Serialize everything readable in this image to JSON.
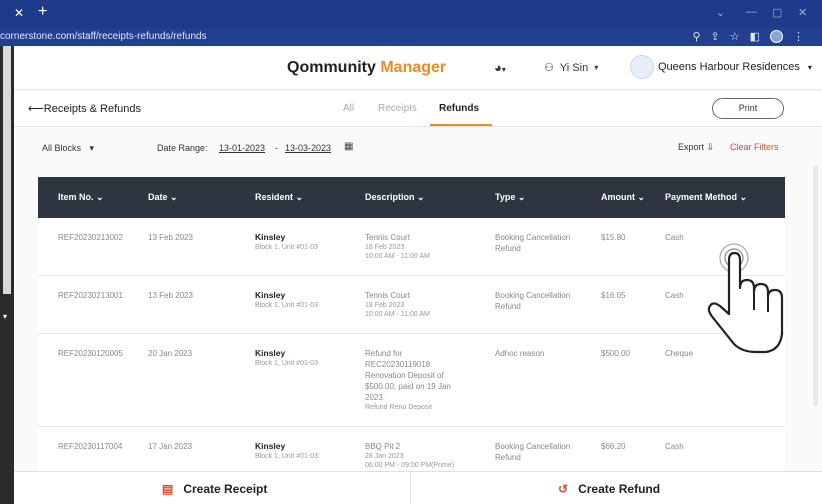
{
  "browser": {
    "url": "cornerstone.com/staff/receipts-refunds/refunds",
    "close_glyph": "✕",
    "new_tab_glyph": "+"
  },
  "header": {
    "brand_prefix": "Qommunity",
    "brand_suffix": "Manager",
    "user": "Yi Sin",
    "org": "Queens Harbour Residences"
  },
  "subbar": {
    "back_label": "Receipts & Refunds",
    "tabs": [
      {
        "label": "All"
      },
      {
        "label": "Receipts"
      },
      {
        "label": "Refunds"
      }
    ],
    "print_label": "Print"
  },
  "filters": {
    "blocks_label": "All Blocks",
    "date_range_label": "Date Range:",
    "date_from": "13-01-2023",
    "date_to": "13-03-2023",
    "export_label": "Export",
    "clear_label": "Clear Filters"
  },
  "table": {
    "columns": [
      "Item No.",
      "Date",
      "Resident",
      "Description",
      "Type",
      "Amount",
      "Payment Method"
    ],
    "rows": [
      {
        "item": "REF20230213002",
        "date": "13 Feb 2023",
        "resident": "Kinsley",
        "unit": "Block 1, Unit #01-03",
        "desc_main": [
          "Tennis Court"
        ],
        "desc_sub": [
          "18 Feb 2023",
          "10:00 AM - 11:00 AM"
        ],
        "type": [
          "Booking Cancellation",
          "Refund"
        ],
        "amount": "$15.80",
        "method": "Cash"
      },
      {
        "item": "REF20230213001",
        "date": "13 Feb 2023",
        "resident": "Kinsley",
        "unit": "Block 1, Unit #01-03",
        "desc_main": [
          "Tennis Court"
        ],
        "desc_sub": [
          "18 Feb 2023",
          "10:00 AM - 11:00 AM"
        ],
        "type": [
          "Booking Cancellation",
          "Refund"
        ],
        "amount": "$16.05",
        "method": "Cash"
      },
      {
        "item": "REF20230120005",
        "date": "20 Jan 2023",
        "resident": "Kinsley",
        "unit": "Block 1, Unit #01-03",
        "desc_main": [
          "Refund for",
          "REC20230119018",
          "Renovation Deposit of",
          "$500.00, paid on 19 Jan",
          "2023."
        ],
        "desc_sub": [
          "Refund Reno Deposit"
        ],
        "type": [
          "Adhoc reason"
        ],
        "amount": "$500.00",
        "method": "Cheque"
      },
      {
        "item": "REF20230117004",
        "date": "17 Jan 2023",
        "resident": "Kinsley",
        "unit": "Block 1, Unit #01-03",
        "desc_main": [
          "BBQ Pit 2"
        ],
        "desc_sub": [
          "28 Jan 2023",
          "06:00 PM - 09:00 PM(Prime)"
        ],
        "type": [
          "Booking Cancellation",
          "Refund"
        ],
        "amount": "$66.20",
        "method": "Cash"
      }
    ]
  },
  "footer": {
    "create_receipt": "Create Receipt",
    "create_refund": "Create Refund"
  },
  "colors": {
    "accent": "#f08a24",
    "danger": "#e0483a",
    "table_header": "#2e3440",
    "chrome": "#1f3a8a"
  },
  "icons": [
    "close-icon",
    "plus-icon",
    "globe-icon",
    "user-icon",
    "print-icon",
    "calendar-icon",
    "download-icon",
    "receipt-icon",
    "refund-icon",
    "hand-pointer-icon"
  ]
}
